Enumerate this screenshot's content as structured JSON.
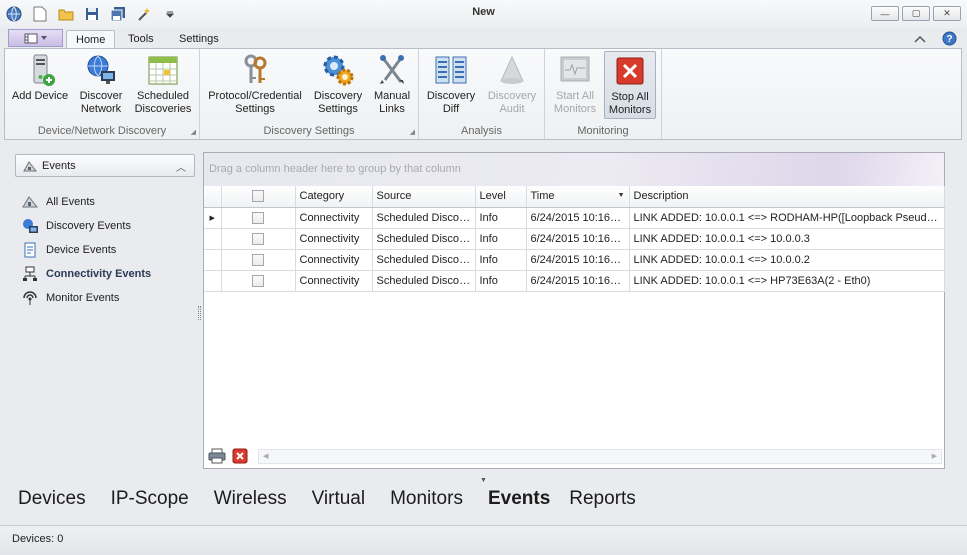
{
  "window": {
    "title": "New",
    "controls": {
      "minimize": "—",
      "maximize": "▢",
      "close": "✕"
    }
  },
  "ribbon_tabs": [
    {
      "label": "Home",
      "active": true
    },
    {
      "label": "Tools",
      "active": false
    },
    {
      "label": "Settings",
      "active": false
    }
  ],
  "ribbon_groups": {
    "device_discovery": {
      "label": "Device/Network Discovery",
      "buttons": [
        "Add Device",
        "Discover Network",
        "Scheduled Discoveries"
      ]
    },
    "discovery_settings": {
      "label": "Discovery Settings",
      "buttons": [
        "Protocol/Credential Settings",
        "Discovery Settings",
        "Manual Links"
      ]
    },
    "analysis": {
      "label": "Analysis",
      "buttons": [
        "Discovery Diff",
        "Discovery Audit"
      ]
    },
    "monitoring": {
      "label": "Monitoring",
      "buttons": [
        "Start All Monitors",
        "Stop All Monitors"
      ]
    }
  },
  "ribbon_labels": {
    "add_device": [
      "Add Device"
    ],
    "discover_network": [
      "Discover",
      "Network"
    ],
    "scheduled_discoveries": [
      "Scheduled",
      "Discoveries"
    ],
    "protocol_settings": [
      "Protocol/Credential",
      "Settings"
    ],
    "discovery_settings": [
      "Discovery",
      "Settings"
    ],
    "manual_links": [
      "Manual",
      "Links"
    ],
    "discovery_diff": [
      "Discovery",
      "Diff"
    ],
    "discovery_audit": [
      "Discovery",
      "Audit"
    ],
    "start_all_monitors": [
      "Start All",
      "Monitors"
    ],
    "stop_all_monitors": [
      "Stop All",
      "Monitors"
    ]
  },
  "sidebar": {
    "header": "Events",
    "items": [
      {
        "label": "All Events",
        "selected": false,
        "icon": "all-events-icon"
      },
      {
        "label": "Discovery Events",
        "selected": false,
        "icon": "discovery-events-icon"
      },
      {
        "label": "Device Events",
        "selected": false,
        "icon": "device-events-icon"
      },
      {
        "label": "Connectivity Events",
        "selected": true,
        "icon": "connectivity-events-icon"
      },
      {
        "label": "Monitor Events",
        "selected": false,
        "icon": "monitor-events-icon"
      }
    ]
  },
  "grid": {
    "group_by_hint": "Drag a column header here to group by that column",
    "columns": [
      "Category",
      "Source",
      "Level",
      "Time",
      "Description"
    ],
    "sorted_column": "Time",
    "rows": [
      {
        "category": "Connectivity",
        "source": "Scheduled Discov…",
        "level": "Info",
        "time": "6/24/2015 10:16…",
        "description": "LINK ADDED: 10.0.0.1 <=> RODHAM-HP([Loopback Pseudo-…"
      },
      {
        "category": "Connectivity",
        "source": "Scheduled Discov…",
        "level": "Info",
        "time": "6/24/2015 10:16…",
        "description": "LINK ADDED: 10.0.0.1 <=> 10.0.0.3"
      },
      {
        "category": "Connectivity",
        "source": "Scheduled Discov…",
        "level": "Info",
        "time": "6/24/2015 10:16…",
        "description": "LINK ADDED: 10.0.0.1 <=> 10.0.0.2"
      },
      {
        "category": "Connectivity",
        "source": "Scheduled Discov…",
        "level": "Info",
        "time": "6/24/2015 10:16…",
        "description": "LINK ADDED: 10.0.0.1 <=> HP73E63A(2 - Eth0)"
      }
    ]
  },
  "modules": [
    {
      "label": "Devices",
      "active": false
    },
    {
      "label": "IP-Scope",
      "active": false
    },
    {
      "label": "Wireless",
      "active": false
    },
    {
      "label": "Virtual",
      "active": false
    },
    {
      "label": "Monitors",
      "active": false
    },
    {
      "label": "Events",
      "active": true
    },
    {
      "label": "Reports",
      "active": false
    }
  ],
  "status": {
    "devices": "Devices: 0"
  },
  "colors": {
    "accent": "#3a6fb0",
    "selected_text": "#2b3a59",
    "stop_red": "#d83b2b"
  }
}
